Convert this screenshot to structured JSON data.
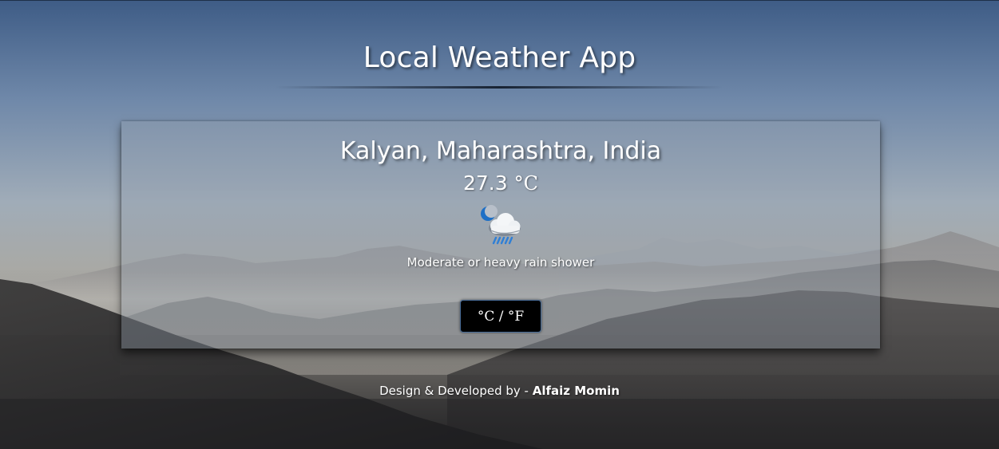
{
  "header": {
    "title": "Local Weather App"
  },
  "weather": {
    "location": "Kalyan, Maharashtra, India",
    "temperature": "27.3",
    "temperature_unit": "°C",
    "condition": "Moderate or heavy rain shower",
    "icon": "night-rain-shower-icon"
  },
  "controls": {
    "unit_toggle_label": "°C / °F"
  },
  "footer": {
    "credit_prefix": "Design & Developed by - ",
    "author": "Alfaiz Momin"
  },
  "colors": {
    "button_background": "#000000",
    "button_border": "#4a6e9a",
    "text": "#ffffff"
  }
}
